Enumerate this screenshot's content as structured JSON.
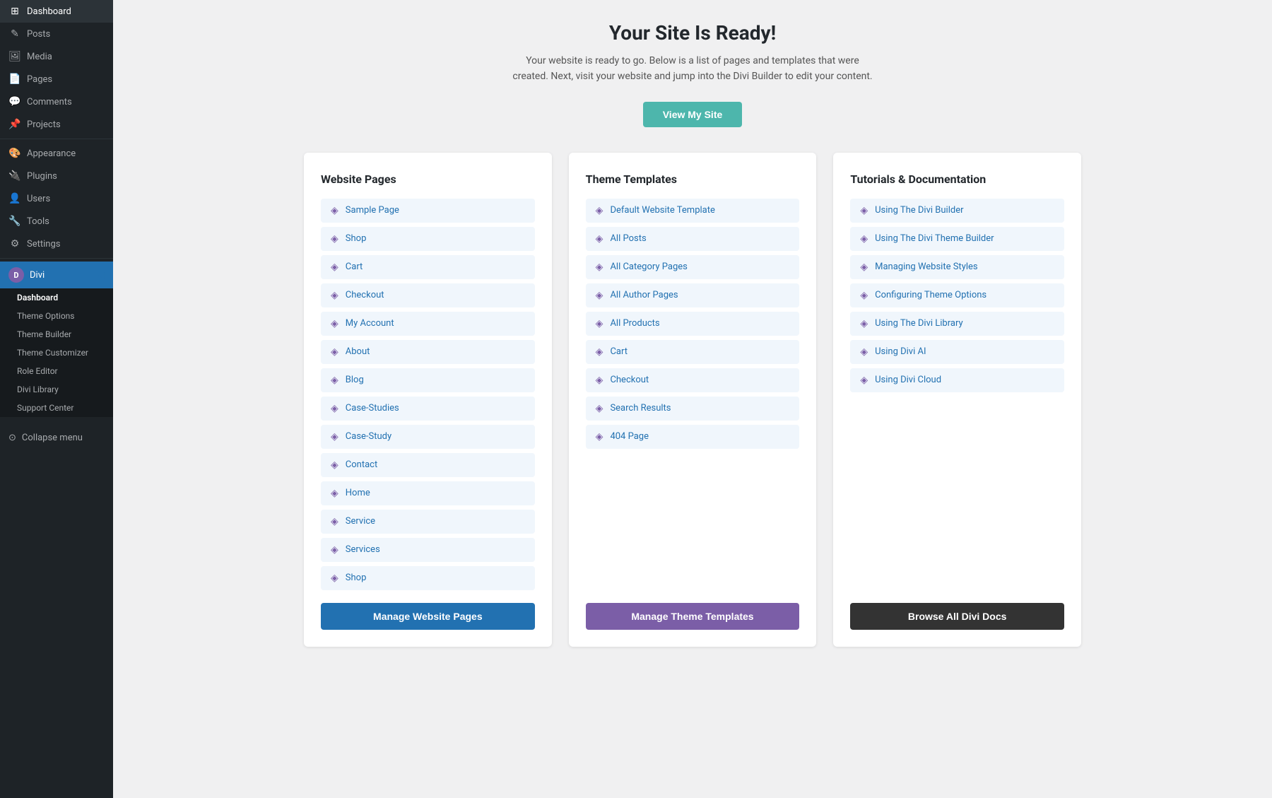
{
  "sidebar": {
    "items": [
      {
        "id": "dashboard",
        "label": "Dashboard",
        "icon": "⊞"
      },
      {
        "id": "posts",
        "label": "Posts",
        "icon": "✎"
      },
      {
        "id": "media",
        "label": "Media",
        "icon": "🖼"
      },
      {
        "id": "pages",
        "label": "Pages",
        "icon": "📄"
      },
      {
        "id": "comments",
        "label": "Comments",
        "icon": "💬"
      },
      {
        "id": "projects",
        "label": "Projects",
        "icon": "📌"
      },
      {
        "id": "appearance",
        "label": "Appearance",
        "icon": "🎨"
      },
      {
        "id": "plugins",
        "label": "Plugins",
        "icon": "🔌"
      },
      {
        "id": "users",
        "label": "Users",
        "icon": "👤"
      },
      {
        "id": "tools",
        "label": "Tools",
        "icon": "🔧"
      },
      {
        "id": "settings",
        "label": "Settings",
        "icon": "⚙"
      }
    ],
    "divi": {
      "label": "Divi",
      "subitems": [
        {
          "id": "dashboard-sub",
          "label": "Dashboard",
          "active": true
        },
        {
          "id": "theme-options",
          "label": "Theme Options"
        },
        {
          "id": "theme-builder",
          "label": "Theme Builder"
        },
        {
          "id": "theme-customizer",
          "label": "Theme Customizer"
        },
        {
          "id": "role-editor",
          "label": "Role Editor"
        },
        {
          "id": "divi-library",
          "label": "Divi Library"
        },
        {
          "id": "support-center",
          "label": "Support Center"
        }
      ]
    },
    "collapse_label": "Collapse menu"
  },
  "main": {
    "title": "Your Site Is Ready!",
    "subtitle": "Your website is ready to go. Below is a list of pages and templates that were created. Next, visit your website and jump into the Divi Builder to edit your content.",
    "view_site_btn": "View My Site",
    "cards": {
      "website_pages": {
        "title": "Website Pages",
        "items": [
          "Sample Page",
          "Shop",
          "Cart",
          "Checkout",
          "My Account",
          "About",
          "Blog",
          "Case-Studies",
          "Case-Study",
          "Contact",
          "Home",
          "Service",
          "Services",
          "Shop"
        ],
        "btn_label": "Manage Website Pages",
        "btn_class": "card-btn-blue"
      },
      "theme_templates": {
        "title": "Theme Templates",
        "items": [
          "Default Website Template",
          "All Posts",
          "All Category Pages",
          "All Author Pages",
          "All Products",
          "Cart",
          "Checkout",
          "Search Results",
          "404 Page"
        ],
        "btn_label": "Manage Theme Templates",
        "btn_class": "card-btn-purple"
      },
      "tutorials": {
        "title": "Tutorials & Documentation",
        "items": [
          "Using The Divi Builder",
          "Using The Divi Theme Builder",
          "Managing Website Styles",
          "Configuring Theme Options",
          "Using The Divi Library",
          "Using Divi AI",
          "Using Divi Cloud"
        ],
        "btn_label": "Browse All Divi Docs",
        "btn_class": "card-btn-dark"
      }
    }
  }
}
